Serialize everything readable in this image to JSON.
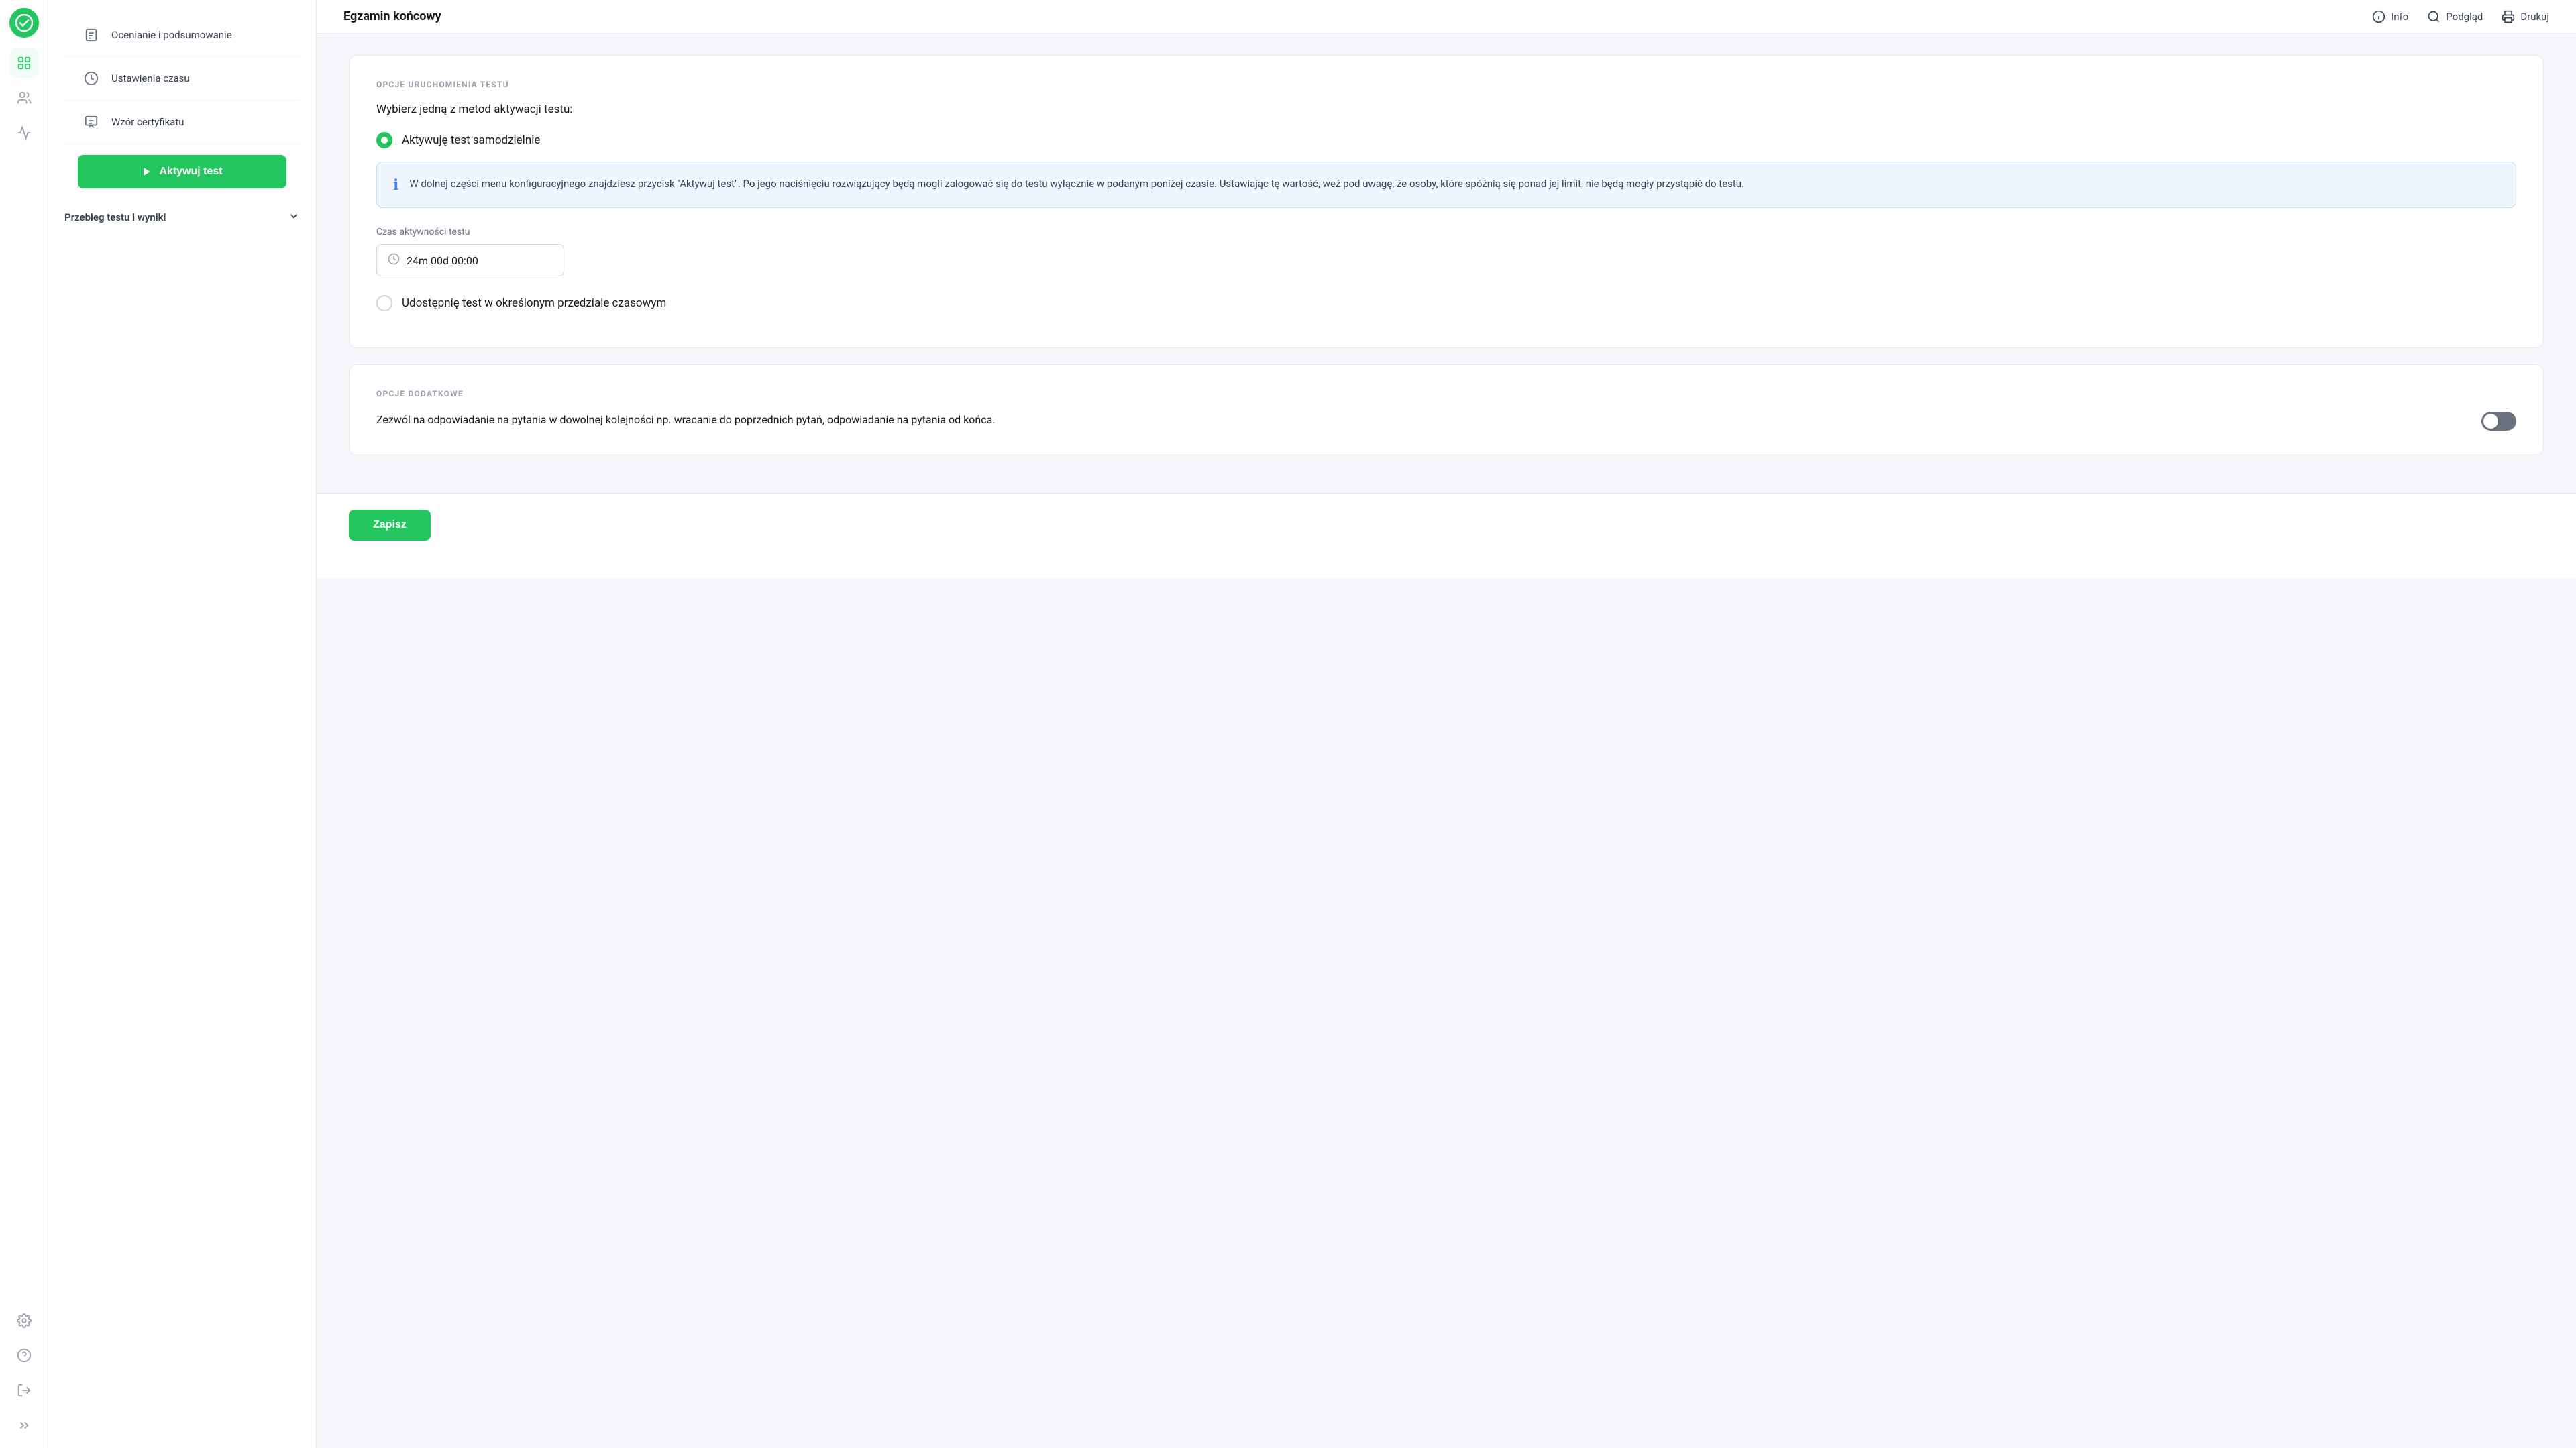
{
  "app": {
    "title": "Egzamin końcowy"
  },
  "topbar": {
    "title": "Egzamin końcowy",
    "info_label": "Info",
    "preview_label": "Podgląd",
    "print_label": "Drukuj"
  },
  "sidebar_narrow": {
    "icons": [
      {
        "name": "logo-icon",
        "label": "Logo"
      },
      {
        "name": "grid-icon",
        "label": "Dashboard"
      },
      {
        "name": "users-icon",
        "label": "Users"
      },
      {
        "name": "chart-icon",
        "label": "Analytics"
      },
      {
        "name": "settings-icon",
        "label": "Settings"
      },
      {
        "name": "help-icon",
        "label": "Help"
      },
      {
        "name": "logout-icon",
        "label": "Logout"
      },
      {
        "name": "expand-icon",
        "label": "Expand"
      }
    ]
  },
  "left_panel": {
    "menu_items": [
      {
        "id": "ocenianie",
        "label": "Ocenianie i podsumowanie",
        "icon": "document-icon"
      },
      {
        "id": "ustawienia-czasu",
        "label": "Ustawienia czasu",
        "icon": "clock-icon"
      },
      {
        "id": "wzor-certyfikatu",
        "label": "Wzór certyfikatu",
        "icon": "certificate-icon"
      }
    ],
    "activate_button_label": "Aktywuj test",
    "section_collapse_label": "Przebieg testu i wyniki"
  },
  "main": {
    "section_run": {
      "section_label": "OPCJE URUCHOMIENIA TESTU",
      "question": "Wybierz jedną z metod aktywacji testu:",
      "radio_options": [
        {
          "id": "self-activate",
          "label": "Aktywuję test samodzielnie",
          "selected": true
        },
        {
          "id": "time-range",
          "label": "Udostępnię test w określonym przedziale czasowym",
          "selected": false
        }
      ],
      "info_box_text": "W dolnej części menu konfiguracyjnego znajdziesz przycisk \"Aktywuj test\". Po jego naciśnięciu rozwiązujący będą mogli zalogować się do testu wyłącznie w podanym poniżej czasie. Ustawiając tę wartość, weź pod uwagę, że osoby, które spóźnią się ponad jej limit, nie będą mogły przystąpić do testu.",
      "time_field_label": "Czas aktywności testu",
      "time_value": "24m 00d 00:00"
    },
    "section_additional": {
      "section_label": "OPCJE DODATKOWE",
      "options": [
        {
          "id": "any-order",
          "text": "Zezwól na odpowiadanie na pytania w dowolnej kolejności np. wracanie do poprzednich pytań, odpowiadanie na pytania od końca.",
          "toggle_enabled": false
        }
      ]
    },
    "save_button_label": "Zapisz"
  }
}
